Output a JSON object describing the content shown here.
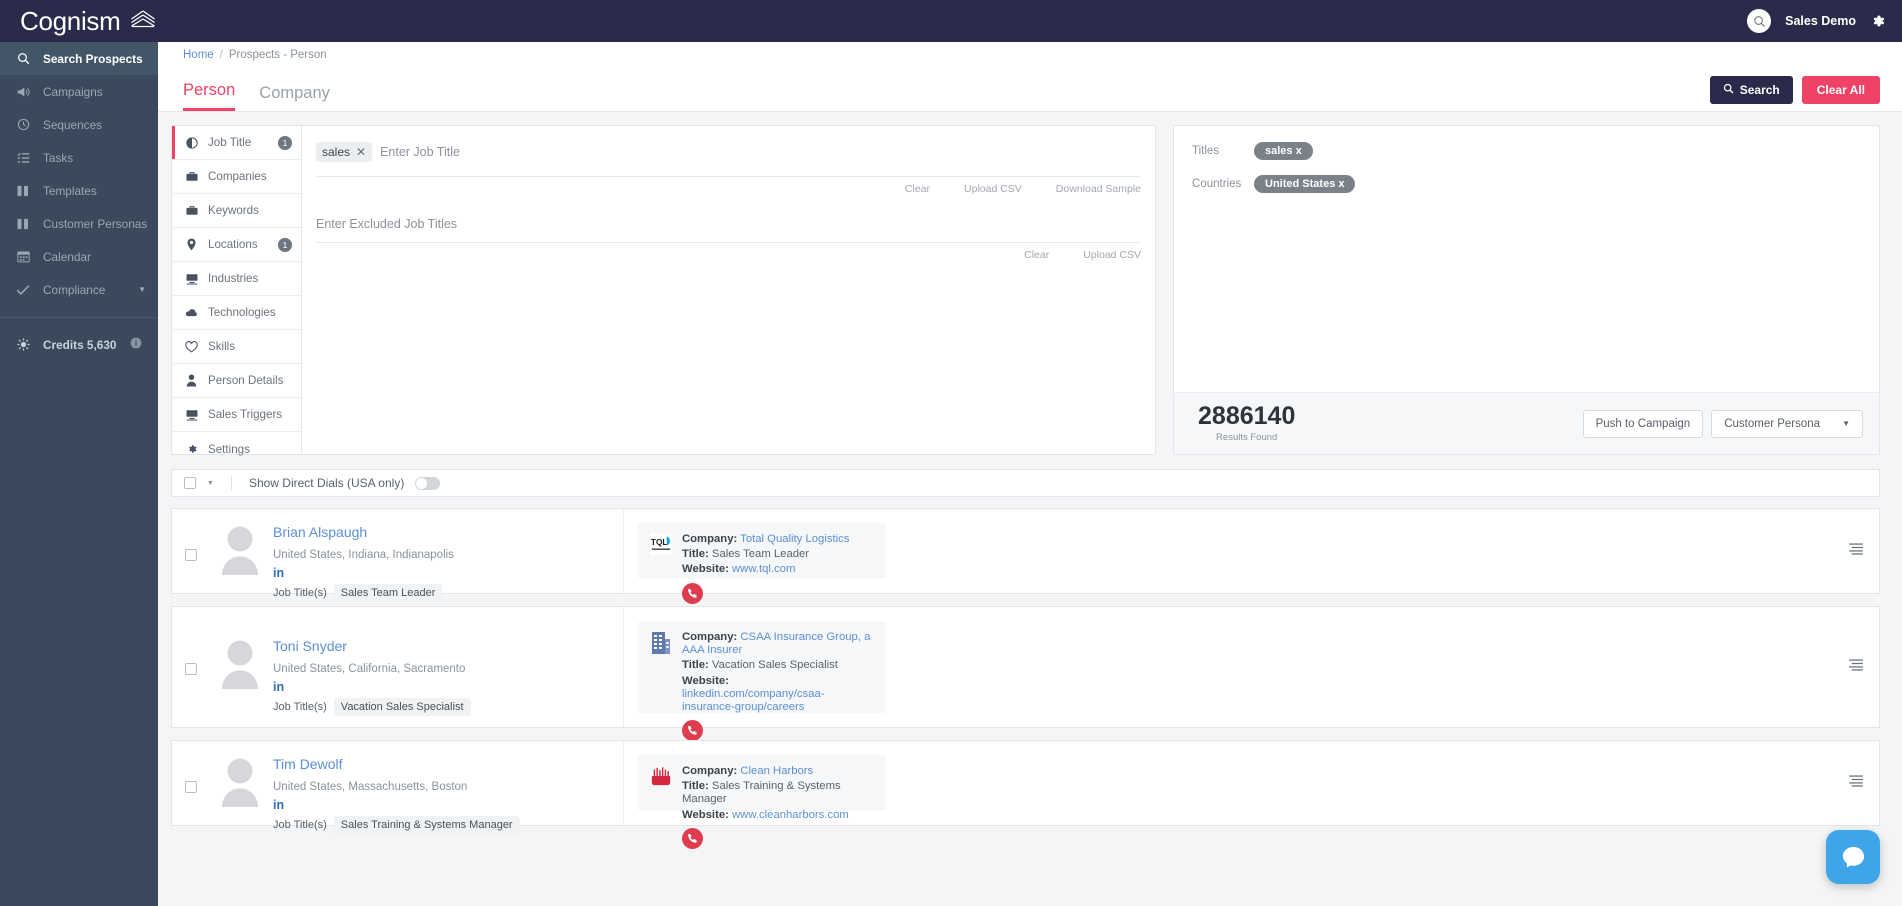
{
  "topbar": {
    "brand": "Cognism",
    "brand_logo_icon": "cognism-roof-icon",
    "search_icon": "search-icon",
    "user_name": "Sales Demo",
    "settings_icon": "gear-icon"
  },
  "sidebar": {
    "items": [
      {
        "label": "Search Prospects",
        "icon": "search-icon",
        "active": true,
        "caret": false
      },
      {
        "label": "Campaigns",
        "icon": "megaphone-icon",
        "active": false,
        "caret": false
      },
      {
        "label": "Sequences",
        "icon": "clock-icon",
        "active": false,
        "caret": false
      },
      {
        "label": "Tasks",
        "icon": "task-list-icon",
        "active": false,
        "caret": false
      },
      {
        "label": "Templates",
        "icon": "columns-icon",
        "active": false,
        "caret": false
      },
      {
        "label": "Customer Personas",
        "icon": "columns-icon",
        "active": false,
        "caret": false
      },
      {
        "label": "Calendar",
        "icon": "calendar-icon",
        "active": false,
        "caret": false
      },
      {
        "label": "Compliance",
        "icon": "check-icon",
        "active": false,
        "caret": true
      }
    ],
    "credits": {
      "label": "Credits 5,630",
      "icon": "sun-burst-icon",
      "info_icon": "info-icon"
    }
  },
  "breadcrumb": {
    "home": "Home",
    "separator": "/",
    "current": "Prospects - Person"
  },
  "tabs": [
    {
      "label": "Person",
      "active": true
    },
    {
      "label": "Company",
      "active": false
    }
  ],
  "actions": {
    "search_label": "Search",
    "search_icon": "search-icon",
    "clear_all_label": "Clear All"
  },
  "filters": {
    "tabs": [
      {
        "label": "Job Title",
        "icon": "contrast-circle-icon",
        "active": true,
        "badge": "1"
      },
      {
        "label": "Companies",
        "icon": "briefcase-icon",
        "active": false,
        "badge": ""
      },
      {
        "label": "Keywords",
        "icon": "briefcase-icon",
        "active": false,
        "badge": ""
      },
      {
        "label": "Locations",
        "icon": "map-pin-icon",
        "active": false,
        "badge": "1"
      },
      {
        "label": "Industries",
        "icon": "desktop-icon",
        "active": false,
        "badge": ""
      },
      {
        "label": "Technologies",
        "icon": "cloud-icon",
        "active": false,
        "badge": ""
      },
      {
        "label": "Skills",
        "icon": "heart-icon",
        "active": false,
        "badge": ""
      },
      {
        "label": "Person Details",
        "icon": "person-icon",
        "active": false,
        "badge": ""
      },
      {
        "label": "Sales Triggers",
        "icon": "desktop-icon",
        "active": false,
        "badge": ""
      },
      {
        "label": "Settings",
        "icon": "gear-icon",
        "active": false,
        "badge": ""
      }
    ],
    "job_title": {
      "chip": "sales",
      "chip_remove_icon": "close-icon",
      "placeholder": "Enter Job Title",
      "links": [
        "Clear",
        "Upload CSV",
        "Download Sample"
      ]
    },
    "excluded_job_title": {
      "placeholder": "Enter Excluded Job Titles",
      "links": [
        "Clear",
        "Upload CSV"
      ]
    }
  },
  "summary": {
    "rows": [
      {
        "label": "Titles",
        "pill": "sales x"
      },
      {
        "label": "Countries",
        "pill": "United States x"
      }
    ],
    "results_count": "2886140",
    "results_caption": "Results Found",
    "push_to_campaign": "Push to Campaign",
    "customer_persona": "Customer Persona",
    "persona_caret_icon": "chevron-down-icon"
  },
  "results_toolbar": {
    "select_all_caret_icon": "chevron-down-icon",
    "direct_dials_label": "Show Direct Dials (USA only)",
    "direct_dials_on": false
  },
  "results": [
    {
      "name": "Brian Alspaugh",
      "location": "United States, Indiana, Indianapolis",
      "linkedin_icon": "linkedin-icon",
      "job_title_label": "Job Title(s)",
      "job_title_tag": "Sales Team Leader",
      "company_label": "Company:",
      "company_name": "Total Quality Logistics",
      "company_logo_icon": "tql-logo-icon",
      "title_label": "Title:",
      "title_value": "Sales Team Leader",
      "website_label": "Website:",
      "website_value": "www.tql.com",
      "phone_icon": "phone-icon",
      "menu_icon": "list-menu-icon"
    },
    {
      "name": "Toni Snyder",
      "location": "United States, California, Sacramento",
      "linkedin_icon": "linkedin-icon",
      "job_title_label": "Job Title(s)",
      "job_title_tag": "Vacation Sales Specialist",
      "company_label": "Company:",
      "company_name": "CSAA Insurance Group, a AAA Insurer",
      "company_logo_icon": "building-logo-icon",
      "title_label": "Title:",
      "title_value": "Vacation Sales Specialist",
      "website_label": "Website:",
      "website_value": "linkedin.com/company/csaa-insurance-group/careers",
      "phone_icon": "phone-icon",
      "menu_icon": "list-menu-icon"
    },
    {
      "name": "Tim Dewolf",
      "location": "United States, Massachusetts, Boston",
      "linkedin_icon": "linkedin-icon",
      "job_title_label": "Job Title(s)",
      "job_title_tag": "Sales Training & Systems Manager",
      "company_label": "Company:",
      "company_name": "Clean Harbors",
      "company_logo_icon": "clean-harbors-logo-icon",
      "title_label": "Title:",
      "title_value": "Sales Training & Systems Manager",
      "website_label": "Website:",
      "website_value": "www.cleanharbors.com",
      "phone_icon": "phone-icon",
      "menu_icon": "list-menu-icon"
    }
  ],
  "chat": {
    "icon": "chat-bubble-icon"
  },
  "colors": {
    "brand_navy": "#2b2a4a",
    "accent_pink": "#ee4266",
    "sidebar": "#3a4a5c",
    "link_blue": "#5b8fd6",
    "phone_red": "#e03c50",
    "chat_blue": "#3da5e8"
  }
}
